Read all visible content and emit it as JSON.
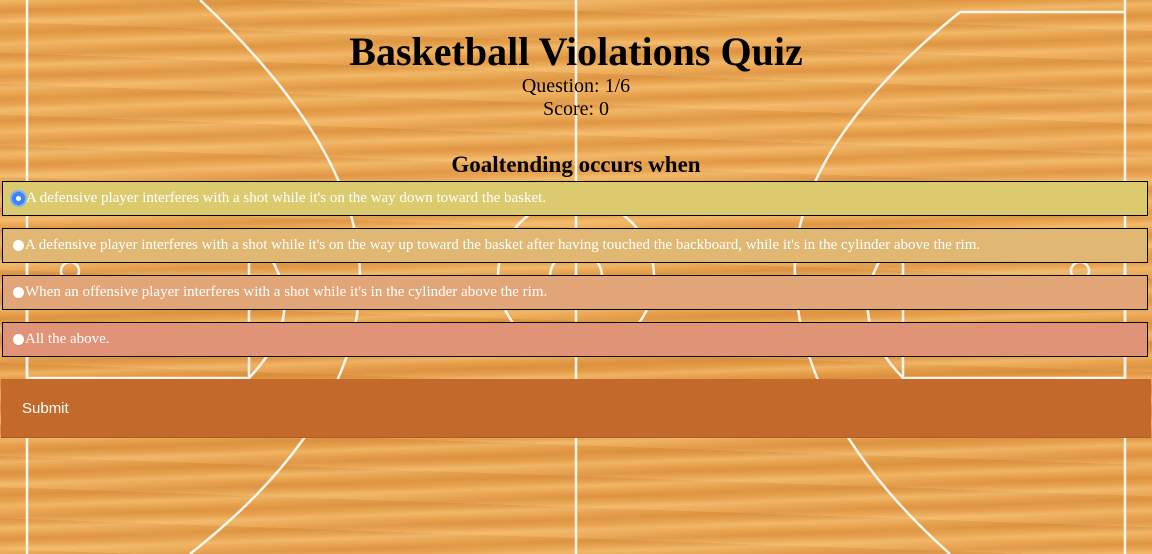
{
  "quiz": {
    "title": "Basketball Violations Quiz",
    "question_counter": "Question: 1/6",
    "score": "Score: 0"
  },
  "question": {
    "text": "Goaltending occurs when",
    "selected_index": 0,
    "options": [
      {
        "label": "A defensive player interferes with a shot while it's on the way down toward the basket.",
        "color": "#dcca6f",
        "checked": true
      },
      {
        "label": "A defensive player interferes with a shot while it's on the way up toward the basket after having touched the backboard, while it's in the cylinder above the rim.",
        "color": "#e1b774",
        "checked": false
      },
      {
        "label": "When an offensive player interferes with a shot while it's in the cylinder above the rim.",
        "color": "#e2a577",
        "checked": false
      },
      {
        "label": "All the above.",
        "color": "#e09377",
        "checked": false
      }
    ]
  },
  "submit": {
    "label": "Submit",
    "color": "#c4692c"
  },
  "theme": {
    "wood_color": "#e8a24a",
    "court_line_color": "#ffffff"
  }
}
